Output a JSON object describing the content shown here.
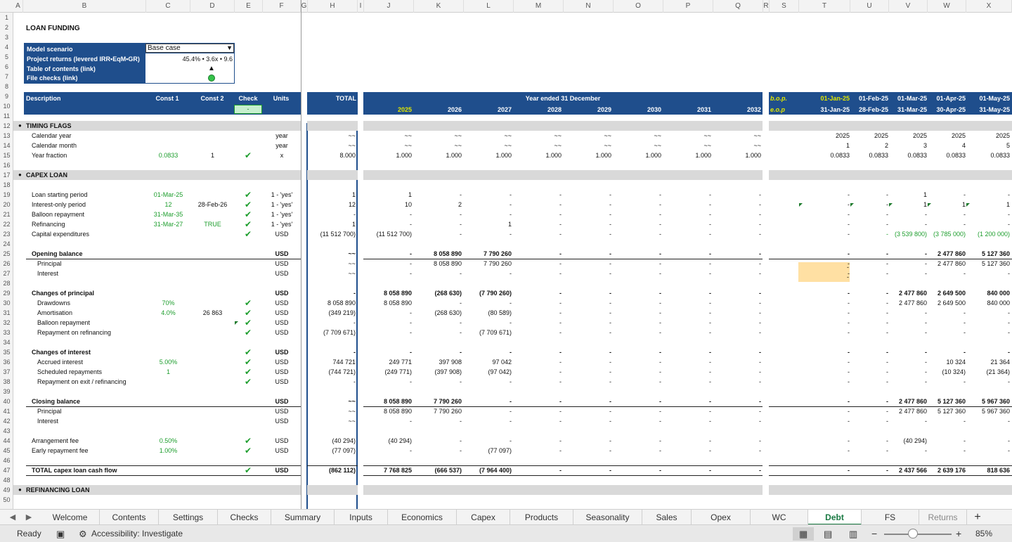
{
  "columns": [
    "A",
    "B",
    "C",
    "D",
    "E",
    "F",
    "G",
    "H",
    "I",
    "J",
    "K",
    "L",
    "M",
    "N",
    "O",
    "P",
    "Q",
    "R",
    "S",
    "T",
    "U",
    "V",
    "W",
    "X"
  ],
  "title": "LOAN FUNDING",
  "info_labels": [
    "Model scenario",
    "Project returns (levered IRR•EqM•GR)",
    "Table of contents (link)",
    "File checks (link)"
  ],
  "scenario": "Base case",
  "returns": "45.4% • 3.6x • 9.6",
  "toc_symbol": "▲",
  "header": {
    "description": "Description",
    "const1": "Const 1",
    "const2": "Const 2",
    "check": "Check",
    "units": "Units",
    "check_value": "-",
    "total": "TOTAL",
    "year_ended": "Year ended 31 December",
    "bop": "b.o.p.",
    "eop": "e.o.p"
  },
  "years": [
    "2025",
    "2026",
    "2027",
    "2028",
    "2029",
    "2030",
    "2031",
    "2032"
  ],
  "month_start": [
    "01-Jan-25",
    "01-Feb-25",
    "01-Mar-25",
    "01-Apr-25",
    "01-May-25"
  ],
  "month_end": [
    "31-Jan-25",
    "28-Feb-25",
    "31-Mar-25",
    "30-Apr-25",
    "31-May-25"
  ],
  "rows": [
    {
      "row": 12,
      "label": "TIMING FLAGS",
      "type": "section"
    },
    {
      "row": 13,
      "label": "Calendar year",
      "units": "year",
      "total": "~~",
      "years": [
        "~~",
        "~~",
        "~~",
        "~~",
        "~~",
        "~~",
        "~~",
        "~~"
      ],
      "months": [
        "2025",
        "2025",
        "2025",
        "2025",
        "2025"
      ]
    },
    {
      "row": 14,
      "label": "Calendar month",
      "units": "year",
      "total": "~~",
      "years": [
        "~~",
        "~~",
        "~~",
        "~~",
        "~~",
        "~~",
        "~~",
        "~~"
      ],
      "months": [
        "1",
        "2",
        "3",
        "4",
        "5"
      ]
    },
    {
      "row": 15,
      "label": "Year fraction",
      "c1": "0.0833",
      "c2": "1",
      "check": true,
      "units": "x",
      "total": "8.000",
      "years": [
        "1.000",
        "1.000",
        "1.000",
        "1.000",
        "1.000",
        "1.000",
        "1.000",
        "1.000"
      ],
      "months": [
        "0.0833",
        "0.0833",
        "0.0833",
        "0.0833",
        "0.0833"
      ]
    },
    {
      "row": 17,
      "label": "CAPEX LOAN",
      "type": "section"
    },
    {
      "row": 19,
      "label": "Loan starting period",
      "c1": "01-Mar-25",
      "check": true,
      "units": "1 - 'yes'",
      "total": "1",
      "years": [
        "1",
        "-",
        "-",
        "-",
        "-",
        "-",
        "-",
        "-"
      ],
      "months": [
        "-",
        "-",
        "1",
        "-",
        "-"
      ]
    },
    {
      "row": 20,
      "label": "Interest-only period",
      "c1": "12",
      "c2": "28-Feb-26",
      "check": true,
      "units": "1 - 'yes'",
      "total": "12",
      "years": [
        "10",
        "2",
        "-",
        "-",
        "-",
        "-",
        "-",
        "-"
      ],
      "months": [
        "-",
        "-",
        "1",
        "1",
        "1"
      ]
    },
    {
      "row": 21,
      "label": "Balloon repayment",
      "c1": "31-Mar-35",
      "check": true,
      "units": "1 - 'yes'",
      "total": "-",
      "years": [
        "-",
        "-",
        "-",
        "-",
        "-",
        "-",
        "-",
        "-"
      ],
      "months": [
        "-",
        "-",
        "-",
        "-",
        "-"
      ]
    },
    {
      "row": 22,
      "label": "Refinancing",
      "c1": "31-Mar-27",
      "c2": "TRUE",
      "c2green": true,
      "check": true,
      "units": "1 - 'yes'",
      "total": "1",
      "years": [
        "-",
        "-",
        "1",
        "-",
        "-",
        "-",
        "-",
        "-"
      ],
      "months": [
        "-",
        "-",
        "-",
        "-",
        "-"
      ]
    },
    {
      "row": 23,
      "label": "Capital expenditures",
      "check": true,
      "units": "USD",
      "total": "(11 512 700)",
      "years": [
        "(11 512 700)",
        "-",
        "-",
        "-",
        "-",
        "-",
        "-",
        "-"
      ],
      "months": [
        "-",
        "-",
        "(3 539 800)",
        "(3 785 000)",
        "(1 200 000)"
      ],
      "monthsgreen": true
    },
    {
      "row": 25,
      "label": "Opening balance",
      "bold": true,
      "units": "USD",
      "total": "~~",
      "years": [
        "-",
        "8 058 890",
        "7 790 260",
        "-",
        "-",
        "-",
        "-",
        "-"
      ],
      "months": [
        "-",
        "-",
        "-",
        "2 477 860",
        "5 127 360"
      ],
      "line": true
    },
    {
      "row": 26,
      "label": "Principal",
      "indent": true,
      "units": "USD",
      "total": "~~",
      "years": [
        "-",
        "8 058 890",
        "7 790 260",
        "-",
        "-",
        "-",
        "-",
        "-"
      ],
      "months": [
        "-",
        "-",
        "-",
        "2 477 860",
        "5 127 360"
      ]
    },
    {
      "row": 27,
      "label": "Interest",
      "indent": true,
      "units": "USD",
      "total": "~~",
      "years": [
        "-",
        "-",
        "-",
        "-",
        "-",
        "-",
        "-",
        "-"
      ],
      "months": [
        "-",
        "-",
        "-",
        "-",
        "-"
      ]
    },
    {
      "row": 29,
      "label": "Changes of principal",
      "bold": true,
      "units": "USD",
      "total": "-",
      "years": [
        "8 058 890",
        "(268 630)",
        "(7 790 260)",
        "-",
        "-",
        "-",
        "-",
        "-"
      ],
      "months": [
        "-",
        "-",
        "2 477 860",
        "2 649 500",
        "840 000"
      ]
    },
    {
      "row": 30,
      "label": "Drawdowns",
      "indent": true,
      "c1": "70%",
      "check": true,
      "units": "USD",
      "total": "8 058 890",
      "years": [
        "8 058 890",
        "-",
        "-",
        "-",
        "-",
        "-",
        "-",
        "-"
      ],
      "months": [
        "-",
        "-",
        "2 477 860",
        "2 649 500",
        "840 000"
      ]
    },
    {
      "row": 31,
      "label": "Amortisation",
      "indent": true,
      "c1": "4.0%",
      "c2": "26 863",
      "check": true,
      "units": "USD",
      "total": "(349 219)",
      "years": [
        "-",
        "(268 630)",
        "(80 589)",
        "-",
        "-",
        "-",
        "-",
        "-"
      ],
      "months": [
        "-",
        "-",
        "-",
        "-",
        "-"
      ]
    },
    {
      "row": 32,
      "label": "Balloon repayment",
      "indent": true,
      "check": true,
      "units": "USD",
      "total": "-",
      "years": [
        "-",
        "-",
        "-",
        "-",
        "-",
        "-",
        "-",
        "-"
      ],
      "months": [
        "-",
        "-",
        "-",
        "-",
        "-"
      ]
    },
    {
      "row": 33,
      "label": "Repayment on refinancing",
      "indent": true,
      "check": true,
      "units": "USD",
      "total": "(7 709 671)",
      "years": [
        "-",
        "-",
        "(7 709 671)",
        "-",
        "-",
        "-",
        "-",
        "-"
      ],
      "months": [
        "-",
        "-",
        "-",
        "-",
        "-"
      ]
    },
    {
      "row": 35,
      "label": "Changes of interest",
      "bold": true,
      "check": true,
      "units": "USD",
      "total": "-",
      "years": [
        "-",
        "-",
        "-",
        "-",
        "-",
        "-",
        "-",
        "-"
      ],
      "months": [
        "-",
        "-",
        "-",
        "-",
        "-"
      ]
    },
    {
      "row": 36,
      "label": "Accrued interest",
      "indent": true,
      "c1": "5.00%",
      "check": true,
      "units": "USD",
      "total": "744 721",
      "years": [
        "249 771",
        "397 908",
        "97 042",
        "-",
        "-",
        "-",
        "-",
        "-"
      ],
      "months": [
        "-",
        "-",
        "-",
        "10 324",
        "21 364"
      ]
    },
    {
      "row": 37,
      "label": "Scheduled repayments",
      "indent": true,
      "c1": "1",
      "check": true,
      "units": "USD",
      "total": "(744 721)",
      "years": [
        "(249 771)",
        "(397 908)",
        "(97 042)",
        "-",
        "-",
        "-",
        "-",
        "-"
      ],
      "months": [
        "-",
        "-",
        "-",
        "(10 324)",
        "(21 364)"
      ]
    },
    {
      "row": 38,
      "label": "Repayment on exit / refinancing",
      "indent": true,
      "check": true,
      "units": "USD",
      "total": "-",
      "years": [
        "-",
        "-",
        "-",
        "-",
        "-",
        "-",
        "-",
        "-"
      ],
      "months": [
        "-",
        "-",
        "-",
        "-",
        "-"
      ]
    },
    {
      "row": 40,
      "label": "Closing balance",
      "bold": true,
      "units": "USD",
      "total": "~~",
      "years": [
        "8 058 890",
        "7 790 260",
        "-",
        "-",
        "-",
        "-",
        "-",
        "-"
      ],
      "months": [
        "-",
        "-",
        "2 477 860",
        "5 127 360",
        "5 967 360"
      ],
      "line": true
    },
    {
      "row": 41,
      "label": "Principal",
      "indent": true,
      "units": "USD",
      "total": "~~",
      "years": [
        "8 058 890",
        "7 790 260",
        "-",
        "-",
        "-",
        "-",
        "-",
        "-"
      ],
      "months": [
        "-",
        "-",
        "2 477 860",
        "5 127 360",
        "5 967 360"
      ]
    },
    {
      "row": 42,
      "label": "Interest",
      "indent": true,
      "units": "USD",
      "total": "~~",
      "years": [
        "-",
        "-",
        "-",
        "-",
        "-",
        "-",
        "-",
        "-"
      ],
      "months": [
        "-",
        "-",
        "-",
        "-",
        "-"
      ]
    },
    {
      "row": 44,
      "label": "Arrangement fee",
      "c1": "0.50%",
      "check": true,
      "units": "USD",
      "total": "(40 294)",
      "years": [
        "(40 294)",
        "-",
        "-",
        "-",
        "-",
        "-",
        "-",
        "-"
      ],
      "months": [
        "-",
        "-",
        "(40 294)",
        "-",
        "-"
      ]
    },
    {
      "row": 45,
      "label": "Early repayment fee",
      "c1": "1.00%",
      "check": true,
      "units": "USD",
      "total": "(77 097)",
      "years": [
        "-",
        "-",
        "(77 097)",
        "-",
        "-",
        "-",
        "-",
        "-"
      ],
      "months": [
        "-",
        "-",
        "-",
        "-",
        "-"
      ]
    },
    {
      "row": 47,
      "label": "TOTAL capex loan cash flow",
      "bold": true,
      "check": true,
      "units": "USD",
      "total": "(862 112)",
      "years": [
        "7 768 825",
        "(666 537)",
        "(7 964 400)",
        "-",
        "-",
        "-",
        "-",
        "-"
      ],
      "months": [
        "-",
        "-",
        "2 437 566",
        "2 639 176",
        "818 636"
      ],
      "line": true,
      "line_below": true
    },
    {
      "row": 49,
      "label": "REFINANCING LOAN",
      "type": "section"
    }
  ],
  "tabs": [
    "Welcome",
    "Contents",
    "Settings",
    "Checks",
    "Summary",
    "Inputs",
    "Economics",
    "Capex",
    "Products",
    "Seasonality",
    "Sales",
    "Opex",
    "WC",
    "Debt",
    "FS",
    "Returns"
  ],
  "active_tab": "Debt",
  "status": {
    "ready": "Ready",
    "accessibility": "Accessibility: Investigate",
    "zoom": "85%"
  },
  "icons": {
    "prev": "triangle-left-icon",
    "next": "triangle-right-icon",
    "add": "plus-icon",
    "macro": "macro-recorder-icon",
    "access": "accessibility-icon",
    "normal": "normal-view-icon",
    "layout": "page-layout-icon",
    "break": "page-break-icon"
  },
  "colors": {
    "navy": "#1f4e8c",
    "green": "#1c9d2c",
    "yellow": "#dfe600",
    "tab_green": "#1a7a43",
    "highlight": "#ffe0a3"
  }
}
